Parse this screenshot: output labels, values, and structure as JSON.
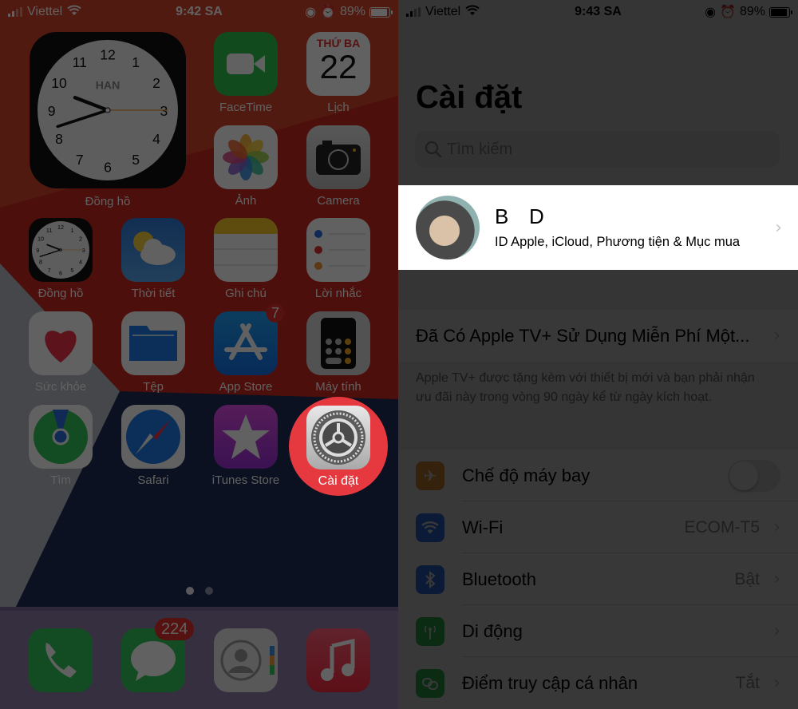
{
  "home": {
    "status": {
      "carrier": "Viettel",
      "time": "9:42 SA",
      "battery": "89%",
      "battery_level": 0.89
    },
    "clock_widget": {
      "city": "HAN",
      "label": "Đồng hồ",
      "numbers": [
        "12",
        "1",
        "2",
        "3",
        "4",
        "5",
        "6",
        "7",
        "8",
        "9",
        "10",
        "11"
      ]
    },
    "apps": [
      {
        "name": "FaceTime",
        "label": "FaceTime"
      },
      {
        "name": "calendar",
        "label": "Lịch",
        "weekday": "THỨ BA",
        "day": "22"
      },
      {
        "name": "photos",
        "label": "Ảnh"
      },
      {
        "name": "camera",
        "label": "Camera"
      },
      {
        "name": "clock",
        "label": "Đồng hồ"
      },
      {
        "name": "weather",
        "label": "Thời tiết"
      },
      {
        "name": "notes",
        "label": "Ghi chú"
      },
      {
        "name": "reminders",
        "label": "Lời nhắc"
      },
      {
        "name": "health",
        "label": "Sức khỏe"
      },
      {
        "name": "files",
        "label": "Tệp"
      },
      {
        "name": "app-store",
        "label": "App Store",
        "badge": "7"
      },
      {
        "name": "calculator",
        "label": "Máy tính"
      },
      {
        "name": "find-my",
        "label": "Tìm"
      },
      {
        "name": "safari",
        "label": "Safari"
      },
      {
        "name": "itunes-store",
        "label": "iTunes Store"
      },
      {
        "name": "settings",
        "label": "Cài đặt"
      }
    ],
    "dock": [
      {
        "name": "phone"
      },
      {
        "name": "messages",
        "badge": "224"
      },
      {
        "name": "contacts"
      },
      {
        "name": "music"
      }
    ],
    "page_dots": 2,
    "highlight_color": "#e5393f"
  },
  "settings": {
    "status": {
      "carrier": "Viettel",
      "time": "9:43 SA",
      "battery": "89%",
      "battery_level": 0.89
    },
    "title": "Cài đặt",
    "search_placeholder": "Tìm kiếm",
    "profile": {
      "name": "B   D",
      "subtitle": "ID Apple, iCloud, Phương tiện & Mục mua"
    },
    "promo": {
      "label": "Đã Có Apple TV+ Sử Dụng Miễn Phí Một...",
      "note": "Apple TV+ được tặng kèm với thiết bị mới và bạn phải nhận ưu đãi này trong vòng 90 ngày kể từ ngày kích hoạt."
    },
    "rows": [
      {
        "label": "Chế độ máy bay",
        "value": "",
        "toggle": false,
        "icon": "airplane-icon",
        "color": "#f09a37"
      },
      {
        "label": "Wi-Fi",
        "value": "ECOM-T5",
        "icon": "wifi-icon",
        "color": "#3478f6"
      },
      {
        "label": "Bluetooth",
        "value": "Bật",
        "icon": "bluetooth-icon",
        "color": "#3478f6"
      },
      {
        "label": "Di động",
        "value": "",
        "icon": "cellular-icon",
        "color": "#34c759"
      },
      {
        "label": "Điểm truy cập cá nhân",
        "value": "Tắt",
        "icon": "hotspot-icon",
        "color": "#34c759"
      }
    ]
  }
}
